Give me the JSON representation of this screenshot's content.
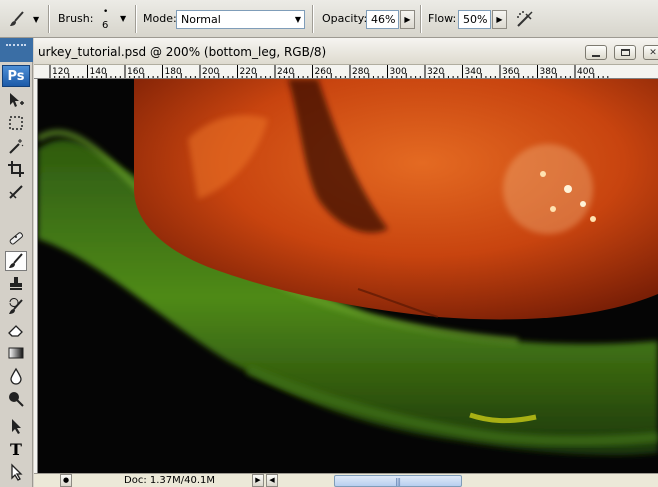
{
  "options_bar": {
    "tool_icon": "brush-icon",
    "brush_label": "Brush:",
    "brush_size": "6",
    "mode_label": "Mode:",
    "mode_value": "Normal",
    "opacity_label": "Opacity:",
    "opacity_value": "46%",
    "flow_label": "Flow:",
    "flow_value": "50%",
    "airbrush_icon": "airbrush-icon"
  },
  "toolbox": {
    "logo": "Ps",
    "tools": [
      {
        "name": "move-tool-icon"
      },
      {
        "name": "marquee-tool-icon"
      },
      {
        "name": "magic-wand-tool-icon"
      },
      {
        "name": "crop-tool-icon"
      },
      {
        "name": "slice-tool-icon"
      },
      {
        "name": "healing-brush-tool-icon"
      },
      {
        "name": "brush-tool-icon",
        "active": true
      },
      {
        "name": "clone-stamp-tool-icon"
      },
      {
        "name": "history-brush-tool-icon"
      },
      {
        "name": "eraser-tool-icon"
      },
      {
        "name": "gradient-tool-icon"
      },
      {
        "name": "blur-tool-icon"
      },
      {
        "name": "dodge-tool-icon"
      },
      {
        "name": "path-selection-tool-icon"
      },
      {
        "name": "type-tool-icon"
      },
      {
        "name": "direct-selection-tool-icon"
      }
    ],
    "type_glyph": "T"
  },
  "document": {
    "title": "urkey_tutorial.psd @ 200% (bottom_leg, RGB/8)",
    "ruler_ticks": [
      "120",
      "140",
      "160",
      "180",
      "200",
      "220",
      "240",
      "260",
      "280",
      "300",
      "320",
      "340",
      "360",
      "380",
      "400"
    ],
    "status_text": "Doc: 1.37M/40.1M"
  },
  "colors": {
    "canvas_bg": "#050505",
    "turkey_orange": "#c8440f",
    "sauce_green": "#3f7a12",
    "toolbox_bg": "#d4d0c8"
  }
}
